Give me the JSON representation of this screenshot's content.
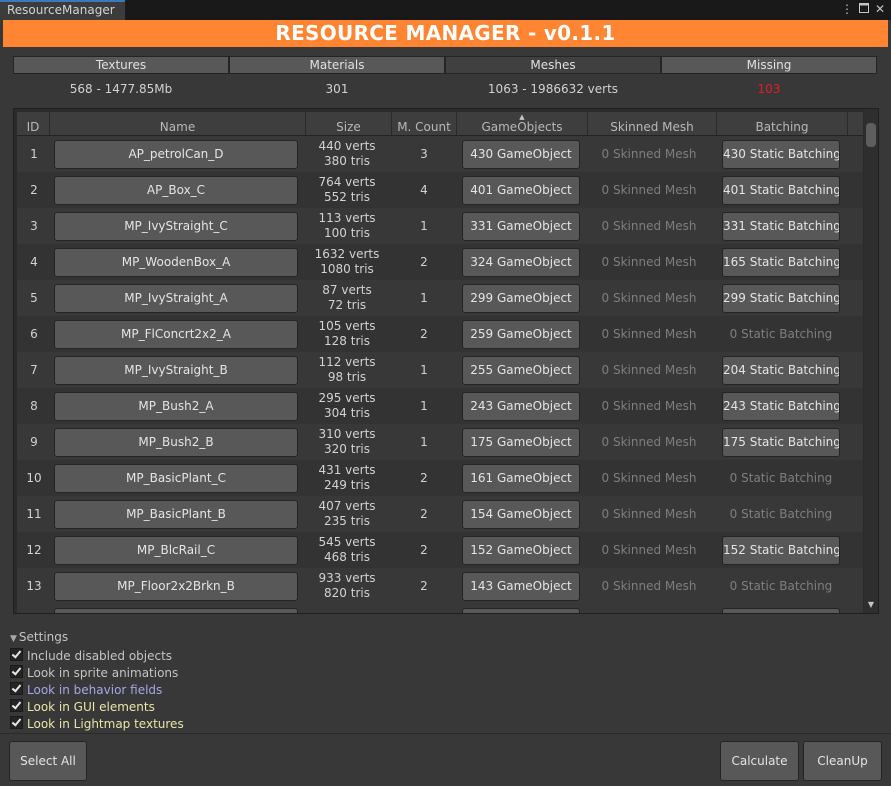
{
  "window": {
    "tab_title": "ResourceManager",
    "menu_icon": "kebab-menu-icon",
    "maximize_icon": "maximize-icon",
    "close_icon": "close-icon"
  },
  "banner": {
    "title": "RESOURCE MANAGER - v0.1.1",
    "color": "#ff8533"
  },
  "tabs": [
    {
      "label": "Textures",
      "active": false
    },
    {
      "label": "Materials",
      "active": false
    },
    {
      "label": "Meshes",
      "active": true
    },
    {
      "label": "Missing",
      "active": false
    }
  ],
  "stats": {
    "textures": "568 - 1477.85Mb",
    "materials": "301",
    "meshes": "1063 - 1986632 verts",
    "missing": "103",
    "missing_color": "#e02020"
  },
  "table": {
    "columns": [
      "ID",
      "Name",
      "Size",
      "M. Count",
      "GameObjects",
      "Skinned Mesh",
      "Batching"
    ],
    "sorted_column": "GameObjects",
    "rows": [
      {
        "id": "1",
        "name": "AP_petrolCan_D",
        "verts": "440 verts",
        "tris": "380 tris",
        "mcount": "3",
        "gameobjects": "430 GameObject",
        "skinned": "0 Skinned Mesh",
        "batching": "430 Static Batching",
        "batching_button": true
      },
      {
        "id": "2",
        "name": "AP_Box_C",
        "verts": "764 verts",
        "tris": "552 tris",
        "mcount": "4",
        "gameobjects": "401 GameObject",
        "skinned": "0 Skinned Mesh",
        "batching": "401 Static Batching",
        "batching_button": true
      },
      {
        "id": "3",
        "name": "MP_IvyStraight_C",
        "verts": "113 verts",
        "tris": "100 tris",
        "mcount": "1",
        "gameobjects": "331 GameObject",
        "skinned": "0 Skinned Mesh",
        "batching": "331 Static Batching",
        "batching_button": true
      },
      {
        "id": "4",
        "name": "MP_WoodenBox_A",
        "verts": "1632 verts",
        "tris": "1080 tris",
        "mcount": "2",
        "gameobjects": "324 GameObject",
        "skinned": "0 Skinned Mesh",
        "batching": "165 Static Batching",
        "batching_button": true
      },
      {
        "id": "5",
        "name": "MP_IvyStraight_A",
        "verts": "87 verts",
        "tris": "72 tris",
        "mcount": "1",
        "gameobjects": "299 GameObject",
        "skinned": "0 Skinned Mesh",
        "batching": "299 Static Batching",
        "batching_button": true
      },
      {
        "id": "6",
        "name": "MP_FlConcrt2x2_A",
        "verts": "105 verts",
        "tris": "128 tris",
        "mcount": "2",
        "gameobjects": "259 GameObject",
        "skinned": "0 Skinned Mesh",
        "batching": "0 Static Batching",
        "batching_button": false
      },
      {
        "id": "7",
        "name": "MP_IvyStraight_B",
        "verts": "112 verts",
        "tris": "98 tris",
        "mcount": "1",
        "gameobjects": "255 GameObject",
        "skinned": "0 Skinned Mesh",
        "batching": "204 Static Batching",
        "batching_button": true
      },
      {
        "id": "8",
        "name": "MP_Bush2_A",
        "verts": "295 verts",
        "tris": "304 tris",
        "mcount": "1",
        "gameobjects": "243 GameObject",
        "skinned": "0 Skinned Mesh",
        "batching": "243 Static Batching",
        "batching_button": true
      },
      {
        "id": "9",
        "name": "MP_Bush2_B",
        "verts": "310 verts",
        "tris": "320 tris",
        "mcount": "1",
        "gameobjects": "175 GameObject",
        "skinned": "0 Skinned Mesh",
        "batching": "175 Static Batching",
        "batching_button": true
      },
      {
        "id": "10",
        "name": "MP_BasicPlant_C",
        "verts": "431 verts",
        "tris": "249 tris",
        "mcount": "2",
        "gameobjects": "161 GameObject",
        "skinned": "0 Skinned Mesh",
        "batching": "0 Static Batching",
        "batching_button": false
      },
      {
        "id": "11",
        "name": "MP_BasicPlant_B",
        "verts": "407 verts",
        "tris": "235 tris",
        "mcount": "2",
        "gameobjects": "154 GameObject",
        "skinned": "0 Skinned Mesh",
        "batching": "0 Static Batching",
        "batching_button": false
      },
      {
        "id": "12",
        "name": "MP_BlcRail_C",
        "verts": "545 verts",
        "tris": "468 tris",
        "mcount": "2",
        "gameobjects": "152 GameObject",
        "skinned": "0 Skinned Mesh",
        "batching": "152 Static Batching",
        "batching_button": true
      },
      {
        "id": "13",
        "name": "MP_Floor2x2Brkn_B",
        "verts": "933 verts",
        "tris": "820 tris",
        "mcount": "2",
        "gameobjects": "143 GameObject",
        "skinned": "0 Skinned Mesh",
        "batching": "0 Static Batching",
        "batching_button": false
      }
    ]
  },
  "settings": {
    "header": "Settings",
    "options": [
      {
        "label": "Include disabled objects",
        "checked": true,
        "color": "#c4c4c4"
      },
      {
        "label": "Look in sprite animations",
        "checked": true,
        "color": "#c4c4c4"
      },
      {
        "label": "Look in behavior fields",
        "checked": true,
        "color": "#a6a6e6"
      },
      {
        "label": "Look in GUI elements",
        "checked": true,
        "color": "#e6e6a6"
      },
      {
        "label": "Look in Lightmap textures",
        "checked": true,
        "color": "#e6e6a6"
      }
    ]
  },
  "footer": {
    "select_all": "Select All",
    "calculate": "Calculate",
    "cleanup": "CleanUp"
  }
}
